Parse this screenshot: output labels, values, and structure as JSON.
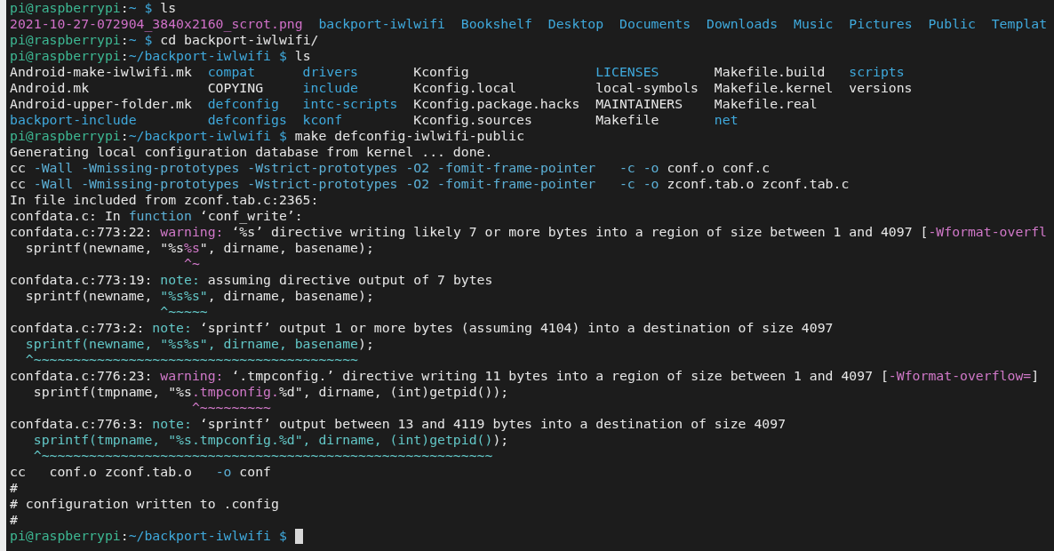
{
  "terminal": {
    "lines": [
      {
        "kind": "prompt",
        "user": "pi@raspberrypi",
        "sep": ":",
        "path": "~ $",
        "command": " ls",
        "cursor": false
      },
      {
        "kind": "ls_row",
        "entries": [
          {
            "name": "2021-10-27-072904_3840x2160_scrot.png",
            "kind": "image"
          },
          {
            "name": "backport-iwlwifi",
            "kind": "dir"
          },
          {
            "name": "Bookshelf",
            "kind": "dir"
          },
          {
            "name": "Desktop",
            "kind": "dir"
          },
          {
            "name": "Documents",
            "kind": "dir"
          },
          {
            "name": "Downloads",
            "kind": "dir"
          },
          {
            "name": "Music",
            "kind": "dir"
          },
          {
            "name": "Pictures",
            "kind": "dir"
          },
          {
            "name": "Public",
            "kind": "dir"
          },
          {
            "name": "Templat",
            "kind": "dir"
          }
        ]
      },
      {
        "kind": "prompt",
        "user": "pi@raspberrypi",
        "sep": ":",
        "path": "~ $",
        "command": " cd backport-iwlwifi/",
        "cursor": false
      },
      {
        "kind": "prompt",
        "user": "pi@raspberrypi",
        "sep": ":",
        "path": "~/backport-iwlwifi $",
        "command": " ls",
        "cursor": false
      },
      {
        "kind": "ls_grid",
        "rows": [
          [
            {
              "name": "Android-make-iwlwifi.mk",
              "kind": "file"
            },
            {
              "name": "compat",
              "kind": "dir"
            },
            {
              "name": "drivers",
              "kind": "dir"
            },
            {
              "name": "Kconfig",
              "kind": "file"
            },
            {
              "name": "LICENSES",
              "kind": "dir"
            },
            {
              "name": "Makefile.build",
              "kind": "file"
            },
            {
              "name": "scripts",
              "kind": "dir"
            }
          ],
          [
            {
              "name": "Android.mk",
              "kind": "file"
            },
            {
              "name": "COPYING",
              "kind": "file"
            },
            {
              "name": "include",
              "kind": "dir"
            },
            {
              "name": "Kconfig.local",
              "kind": "file"
            },
            {
              "name": "local-symbols",
              "kind": "file"
            },
            {
              "name": "Makefile.kernel",
              "kind": "file"
            },
            {
              "name": "versions",
              "kind": "file"
            }
          ],
          [
            {
              "name": "Android-upper-folder.mk",
              "kind": "file"
            },
            {
              "name": "defconfig",
              "kind": "dir"
            },
            {
              "name": "intc-scripts",
              "kind": "dir"
            },
            {
              "name": "Kconfig.package.hacks",
              "kind": "file"
            },
            {
              "name": "MAINTAINERS",
              "kind": "file"
            },
            {
              "name": "Makefile.real",
              "kind": "file"
            }
          ],
          [
            {
              "name": "backport-include",
              "kind": "dir"
            },
            {
              "name": "defconfigs",
              "kind": "dir"
            },
            {
              "name": "kconf",
              "kind": "dir"
            },
            {
              "name": "Kconfig.sources",
              "kind": "file"
            },
            {
              "name": "Makefile",
              "kind": "file"
            },
            {
              "name": "net",
              "kind": "dir"
            }
          ]
        ]
      },
      {
        "kind": "prompt",
        "user": "pi@raspberrypi",
        "sep": ":",
        "path": "~/backport-iwlwifi $",
        "command": " make defconfig-iwlwifi-public",
        "cursor": false
      },
      {
        "kind": "output",
        "segments": [
          {
            "kind": "plain",
            "text": "Generating local configuration database from kernel ... done."
          }
        ]
      },
      {
        "kind": "output",
        "segments": [
          {
            "kind": "plain",
            "text": "cc "
          },
          {
            "kind": "flag",
            "text": "-Wall -Wmissing-prototypes -Wstrict-prototypes -O2 -fomit-frame-pointer   -c -o"
          },
          {
            "kind": "plain",
            "text": " conf.o conf.c"
          }
        ]
      },
      {
        "kind": "output",
        "segments": [
          {
            "kind": "plain",
            "text": "cc "
          },
          {
            "kind": "flag",
            "text": "-Wall -Wmissing-prototypes -Wstrict-prototypes -O2 -fomit-frame-pointer   -c -o"
          },
          {
            "kind": "plain",
            "text": " zconf.tab.o zconf.tab.c"
          }
        ]
      },
      {
        "kind": "output",
        "segments": [
          {
            "kind": "plain",
            "text": "In file included from zconf.tab.c:2365:"
          }
        ]
      },
      {
        "kind": "output",
        "segments": [
          {
            "kind": "plain",
            "text": "confdata.c: In "
          },
          {
            "kind": "flag",
            "text": "function"
          },
          {
            "kind": "plain",
            "text": " ‘conf_write’:"
          }
        ]
      },
      {
        "kind": "output",
        "segments": [
          {
            "kind": "plain",
            "text": "confdata.c:773:22: "
          },
          {
            "kind": "warning",
            "text": "warning:"
          },
          {
            "kind": "plain",
            "text": " ‘%s’ directive writing likely 7 or more bytes into a region of size between 1 and 4097 ["
          },
          {
            "kind": "warning",
            "text": "-Wformat-overfl"
          }
        ]
      },
      {
        "kind": "output",
        "segments": [
          {
            "kind": "plain",
            "text": "  sprintf(newname, \"%s"
          },
          {
            "kind": "warning",
            "text": "%s"
          },
          {
            "kind": "plain",
            "text": "\", dirname, basename);"
          }
        ]
      },
      {
        "kind": "output",
        "segments": [
          {
            "kind": "warning",
            "text": "                      ^~"
          }
        ]
      },
      {
        "kind": "output",
        "segments": [
          {
            "kind": "plain",
            "text": "confdata.c:773:19: "
          },
          {
            "kind": "note",
            "text": "note:"
          },
          {
            "kind": "plain",
            "text": " assuming directive output of 7 bytes"
          }
        ]
      },
      {
        "kind": "output",
        "segments": [
          {
            "kind": "plain",
            "text": "  sprintf(newname, "
          },
          {
            "kind": "note",
            "text": "\"%s%s\""
          },
          {
            "kind": "plain",
            "text": ", dirname, basename);"
          }
        ]
      },
      {
        "kind": "output",
        "segments": [
          {
            "kind": "note",
            "text": "                   ^~~~~~"
          }
        ]
      },
      {
        "kind": "output",
        "segments": [
          {
            "kind": "plain",
            "text": "confdata.c:773:2: "
          },
          {
            "kind": "note",
            "text": "note:"
          },
          {
            "kind": "plain",
            "text": " ‘sprintf’ output 1 or more bytes (assuming 4104) into a destination of size 4097"
          }
        ]
      },
      {
        "kind": "output",
        "segments": [
          {
            "kind": "note",
            "text": "  sprintf(newname, \"%s%s\", dirname, basename"
          },
          {
            "kind": "plain",
            "text": ");"
          }
        ]
      },
      {
        "kind": "output",
        "segments": [
          {
            "kind": "note",
            "text": "  ^~~~~~~~~~~~~~~~~~~~~~~~~~~~~~~~~~~~~~~~~~"
          }
        ]
      },
      {
        "kind": "output",
        "segments": [
          {
            "kind": "plain",
            "text": "confdata.c:776:23: "
          },
          {
            "kind": "warning",
            "text": "warning:"
          },
          {
            "kind": "plain",
            "text": " ‘.tmpconfig.’ directive writing 11 bytes into a region of size between 1 and 4097 ["
          },
          {
            "kind": "warning",
            "text": "-Wformat-overflow="
          },
          {
            "kind": "plain",
            "text": "]"
          }
        ]
      },
      {
        "kind": "output",
        "segments": [
          {
            "kind": "plain",
            "text": "   sprintf(tmpname, \"%s"
          },
          {
            "kind": "warning",
            "text": ".tmpconfig."
          },
          {
            "kind": "plain",
            "text": "%d\", dirname, (int)getpid());"
          }
        ]
      },
      {
        "kind": "output",
        "segments": [
          {
            "kind": "warning",
            "text": "                       ^~~~~~~~~~"
          }
        ]
      },
      {
        "kind": "output",
        "segments": [
          {
            "kind": "plain",
            "text": "confdata.c:776:3: "
          },
          {
            "kind": "note",
            "text": "note:"
          },
          {
            "kind": "plain",
            "text": " ‘sprintf’ output between 13 and 4119 bytes into a destination of size 4097"
          }
        ]
      },
      {
        "kind": "output",
        "segments": [
          {
            "kind": "note",
            "text": "   sprintf(tmpname, \"%s.tmpconfig.%d\", dirname, (int)getpid()"
          },
          {
            "kind": "plain",
            "text": ");"
          }
        ]
      },
      {
        "kind": "output",
        "segments": [
          {
            "kind": "note",
            "text": "   ^~~~~~~~~~~~~~~~~~~~~~~~~~~~~~~~~~~~~~~~~~~~~~~~~~~~~~~~~~"
          }
        ]
      },
      {
        "kind": "output",
        "segments": [
          {
            "kind": "plain",
            "text": "cc   conf.o zconf.tab.o   "
          },
          {
            "kind": "flag",
            "text": "-o"
          },
          {
            "kind": "plain",
            "text": " conf"
          }
        ]
      },
      {
        "kind": "output",
        "segments": [
          {
            "kind": "plain",
            "text": "#"
          }
        ]
      },
      {
        "kind": "output",
        "segments": [
          {
            "kind": "plain",
            "text": "# configuration written to .config"
          }
        ]
      },
      {
        "kind": "output",
        "segments": [
          {
            "kind": "plain",
            "text": "#"
          }
        ]
      },
      {
        "kind": "prompt",
        "user": "pi@raspberrypi",
        "sep": ":",
        "path": "~/backport-iwlwifi $",
        "cursor": true
      }
    ]
  }
}
